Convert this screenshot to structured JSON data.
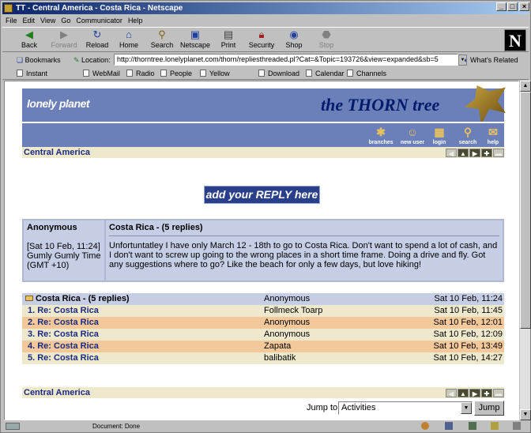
{
  "window": {
    "title": "TT - Central America - Costa Rica - Netscape"
  },
  "menu": [
    "File",
    "Edit",
    "View",
    "Go",
    "Communicator",
    "Help"
  ],
  "nav_buttons": [
    {
      "label": "Back",
      "icon": "back-arrow-icon"
    },
    {
      "label": "Forward",
      "icon": "forward-arrow-icon"
    },
    {
      "label": "Reload",
      "icon": "reload-icon"
    },
    {
      "label": "Home",
      "icon": "home-icon"
    },
    {
      "label": "Search",
      "icon": "search-icon"
    },
    {
      "label": "Netscape",
      "icon": "netscape-icon"
    },
    {
      "label": "Print",
      "icon": "print-icon"
    },
    {
      "label": "Security",
      "icon": "lock-icon"
    },
    {
      "label": "Shop",
      "icon": "shop-icon"
    },
    {
      "label": "Stop",
      "icon": "stop-icon"
    }
  ],
  "location": {
    "bookmarks_label": "Bookmarks",
    "location_label": "Location:",
    "url": "http://thorntree.lonelyplanet.com/thorn/repliesthreaded.pl?Cat=&Topic=193726&view=expanded&sb=5",
    "whats_related": "What's Related"
  },
  "personal_toolbar": [
    "Instant Message",
    "WebMail",
    "Radio",
    "People",
    "Yellow Pages",
    "Download",
    "Calendar",
    "Channels"
  ],
  "page": {
    "logo": "lonely planet",
    "banner_title": "the THORN tree",
    "thorn_icons": [
      "branches",
      "new user",
      "login",
      "search",
      "help"
    ],
    "section_title": "Central America",
    "reply_button": "add your REPLY here",
    "message": {
      "author": "Anonymous",
      "date": "[Sat 10 Feb, 11:24]",
      "location": "Gumly Gumly Time (GMT +10)",
      "subject": "Costa Rica - (5 replies)",
      "body": "Unfortuntatley I have only March 12 - 18th to go to Costa Rica. Don't want to spend a lot of cash, and I don't want to screw up going to the wrong places in a short time frame. Doing a drive and fly. Got any suggestions where to go? Like the beach for only a few days, but love hiking!"
    },
    "thread": [
      {
        "title": "Costa Rica - (5 replies)",
        "author": "Anonymous",
        "date": "Sat 10 Feb, 11:24"
      },
      {
        "title": "1. Re: Costa Rica",
        "author": "Follmeck Toarp",
        "date": "Sat 10 Feb, 11:45"
      },
      {
        "title": "2. Re: Costa Rica",
        "author": "Anonymous",
        "date": "Sat 10 Feb, 12:01"
      },
      {
        "title": "3. Re: Costa Rica",
        "author": "Anonymous",
        "date": "Sat 10 Feb, 12:09"
      },
      {
        "title": "4. Re: Costa Rica",
        "author": "Zapata",
        "date": "Sat 10 Feb, 13:49"
      },
      {
        "title": "5. Re: Costa Rica",
        "author": "balibatik",
        "date": "Sat 10 Feb, 14:27"
      }
    ],
    "jump_label": "Jump to",
    "jump_value": "Activities",
    "jump_button": "Jump"
  },
  "status": {
    "text": "Document: Done"
  }
}
